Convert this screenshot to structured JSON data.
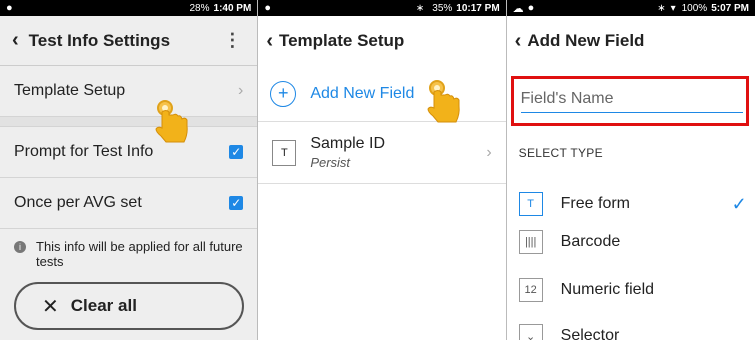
{
  "screen1": {
    "status": {
      "battery": "28%",
      "time": "1:40 PM"
    },
    "header": {
      "title": "Test Info Settings",
      "back_icon": "chevron-left",
      "menu_icon": "more-vert"
    },
    "rows": [
      {
        "label": "Template Setup"
      },
      {
        "label": "Prompt for Test Info",
        "checked": true
      },
      {
        "label": "Once per AVG set",
        "checked": true
      }
    ],
    "info_text": "This info will be applied for all future tests",
    "clear_button": "Clear all"
  },
  "screen2": {
    "status": {
      "battery": "35%",
      "time": "10:17 PM"
    },
    "header": {
      "title": "Template Setup"
    },
    "add_field": "Add New Field",
    "item": {
      "icon_text": "T",
      "title": "Sample ID",
      "subtitle": "Persist"
    }
  },
  "screen3": {
    "status": {
      "battery": "100%",
      "time": "5:07 PM"
    },
    "header": {
      "title": "Add New Field"
    },
    "field_placeholder": "Field's Name",
    "select_type_label": "SELECT TYPE",
    "types": [
      {
        "icon_text": "T",
        "label": "Free form",
        "selected": true
      },
      {
        "icon_text": "||||",
        "label": "Barcode"
      },
      {
        "icon_text": "12",
        "label": "Numeric field"
      },
      {
        "icon_text": "⌄",
        "label": "Selector"
      }
    ]
  },
  "colors": {
    "accent": "#1e88e5",
    "highlight": "#e01010",
    "hand": "#f2b21a"
  }
}
